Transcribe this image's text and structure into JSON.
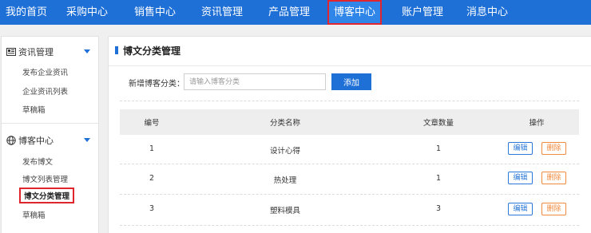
{
  "topnav": {
    "items": [
      "我的首页",
      "采购中心",
      "销售中心",
      "资讯管理",
      "产品管理",
      "博客中心",
      "账户管理",
      "消息中心"
    ],
    "active": "博客中心"
  },
  "sidebar": {
    "sections": [
      {
        "title": "资讯管理",
        "icon": "newspaper-icon",
        "links": [
          "发布企业资讯",
          "企业资讯列表",
          "草稿箱"
        ]
      },
      {
        "title": "博客中心",
        "icon": "globe-icon",
        "links": [
          "发布博文",
          "博文列表管理",
          "博文分类管理",
          "草稿箱"
        ],
        "active_link": "博文分类管理"
      }
    ]
  },
  "main": {
    "title": "博文分类管理",
    "form": {
      "label": "新增博客分类：",
      "placeholder": "请输入博客分类",
      "button": "添加"
    },
    "table": {
      "headers": [
        "编号",
        "分类名称",
        "文章数量",
        "操作"
      ],
      "rows": [
        {
          "id": "1",
          "name": "设计心得",
          "count": "1"
        },
        {
          "id": "2",
          "name": "热处理",
          "count": "1"
        },
        {
          "id": "3",
          "name": "塑料模具",
          "count": "3"
        }
      ],
      "edit_label": "编辑",
      "delete_label": "删除"
    }
  },
  "colors": {
    "brand_blue": "#1e6fd6",
    "highlight_red": "#e1252f",
    "delete_orange": "#f08a3c"
  }
}
